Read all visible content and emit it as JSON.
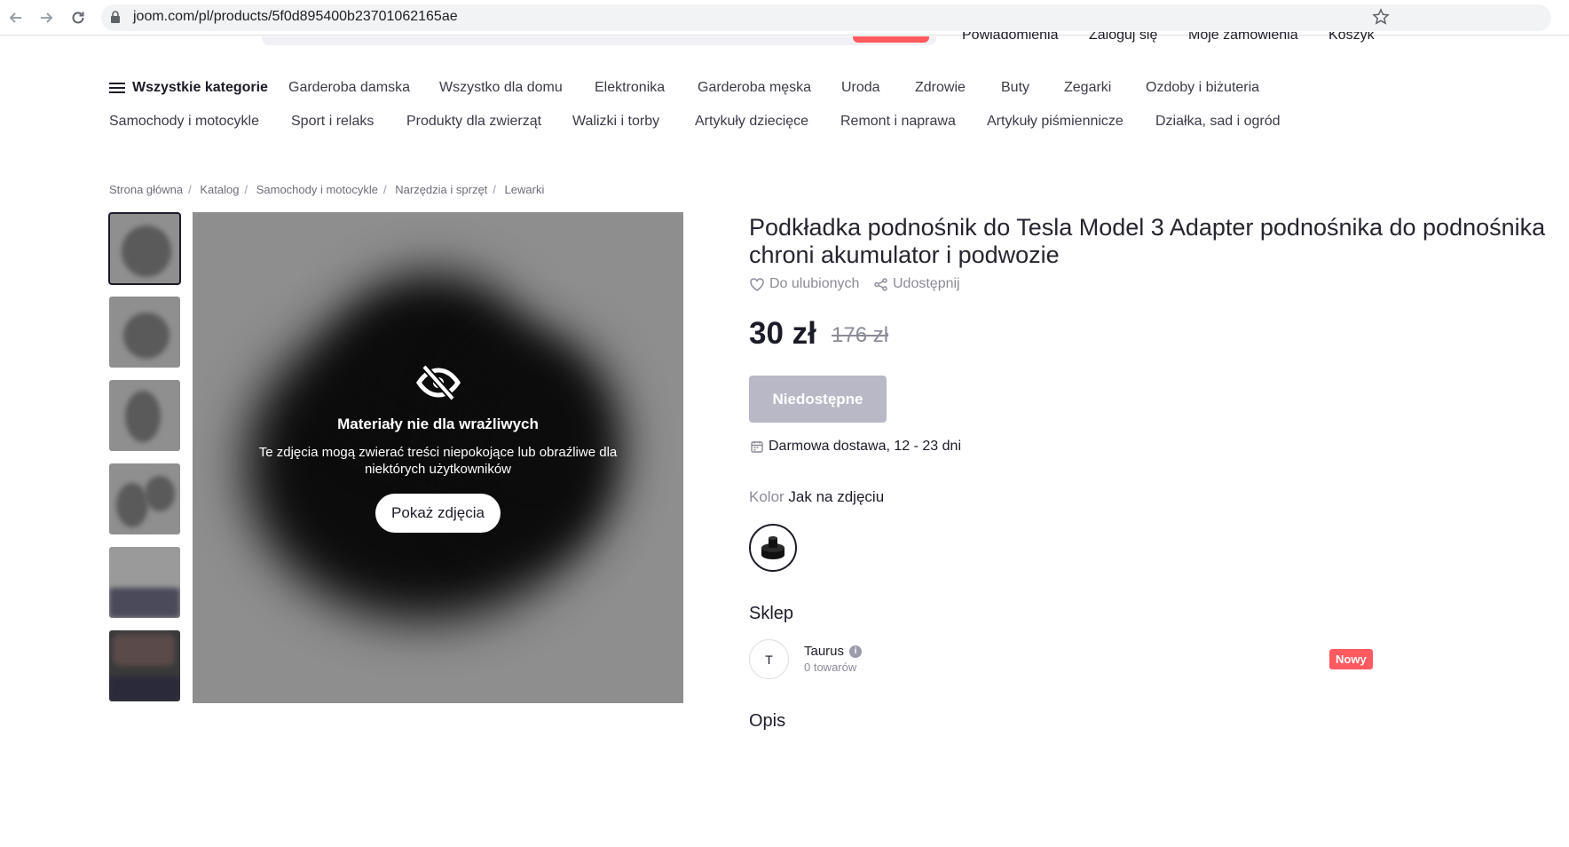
{
  "browser": {
    "url": "joom.com/pl/products/5f0d895400b23701062165ae"
  },
  "header": {
    "links": [
      "Powiadomienia",
      "Zaloguj się",
      "Moje zamówienia",
      "Koszyk"
    ]
  },
  "categories": {
    "all_label": "Wszystkie kategorie",
    "row1": [
      "Garderoba damska",
      "Wszystko dla domu",
      "Elektronika",
      "Garderoba męska",
      "Uroda",
      "Zdrowie",
      "Buty",
      "Zegarki",
      "Ozdoby i biżuteria"
    ],
    "row2": [
      "Samochody i motocykle",
      "Sport i relaks",
      "Produkty dla zwierząt",
      "Walizki i torby",
      "Artykuły dziecięce",
      "Remont i naprawa",
      "Artykuły piśmiennicze",
      "Działka, sad i ogród"
    ]
  },
  "breadcrumbs": [
    "Strona główna",
    "Katalog",
    "Samochody i motocykle",
    "Narzędzia i sprzęt",
    "Lewarki"
  ],
  "gallery": {
    "thumb_count": 6,
    "sensitive_title": "Materiały nie dla wrażliwych",
    "sensitive_text": "Te zdjęcia mogą zwierać treści niepokojące lub obraźliwe dla niektórych użytkowników",
    "show_button": "Pokaż zdjęcia"
  },
  "product": {
    "title": "Podkładka podnośnik do Tesla Model 3 Adapter podnośnika do podnośnika chroni akumulator i podwozie",
    "favorite_label": "Do ulubionych",
    "share_label": "Udostępnij",
    "price": "30 zł",
    "old_price": "176 zł",
    "unavailable_label": "Niedostępne",
    "delivery": "Darmowa dostawa, 12 - 23 dni",
    "color_label": "Kolor",
    "color_value": "Jak na zdjęciu"
  },
  "shop": {
    "heading": "Sklep",
    "avatar_letter": "T",
    "name": "Taurus",
    "count": "0 towarów",
    "badge": "Nowy"
  },
  "description": {
    "heading": "Opis"
  }
}
